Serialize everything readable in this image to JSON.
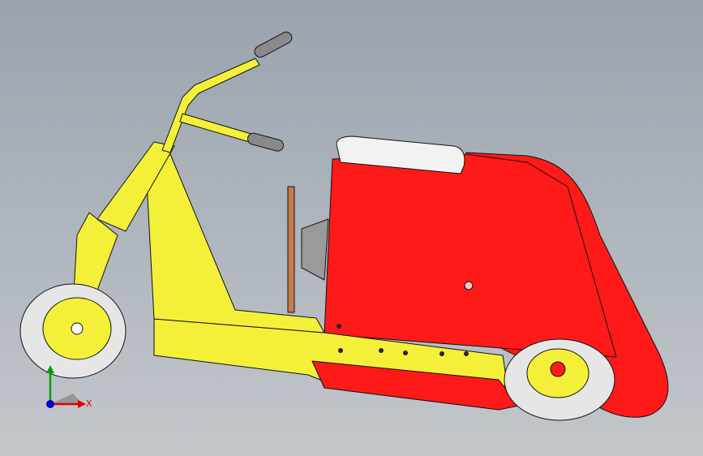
{
  "viewport": {
    "background_top": "#9aa3ad",
    "background_bottom": "#c3c7cc"
  },
  "model": {
    "body_color": "#ff1a1a",
    "frame_color": "#f4f03a",
    "seat_color": "#f2f2f2",
    "tire_color": "#e6e6e6",
    "hub_color": "#f4f03a",
    "grip_color": "#8a8a8a",
    "panel_color": "#9a9a9a",
    "edge_color": "#111111"
  },
  "triad": {
    "x_label": "X",
    "x_color": "#e00000",
    "y_color": "#00a000",
    "z_color": "#0000c8"
  }
}
